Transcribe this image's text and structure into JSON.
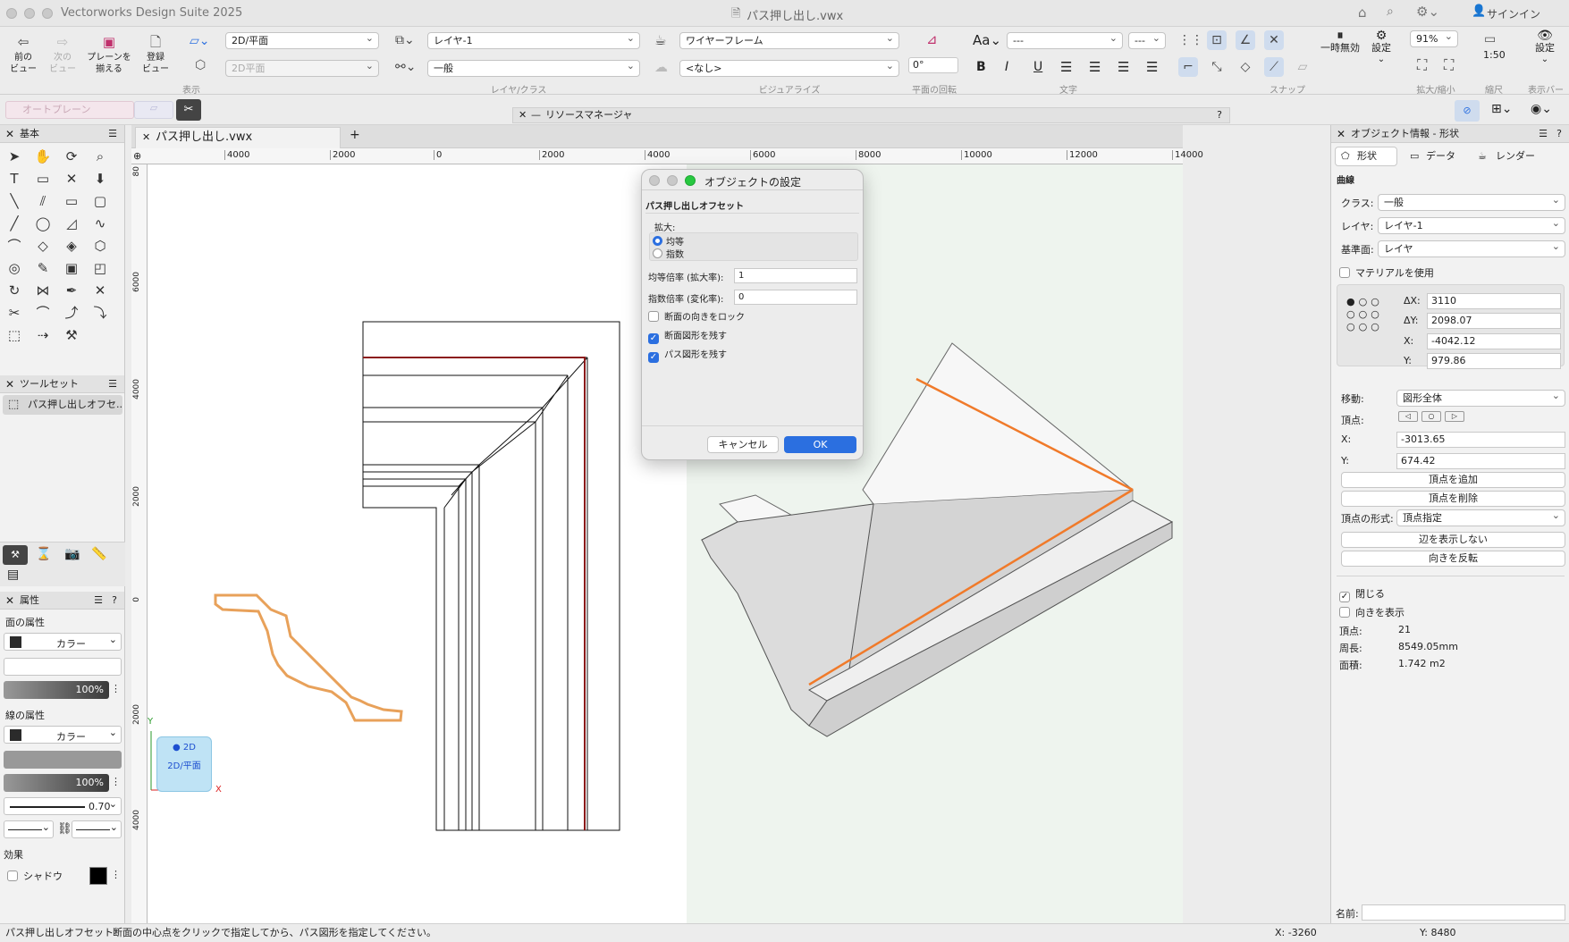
{
  "app": {
    "title": "Vectorworks Design Suite 2025",
    "document": "パス押し出し.vwx",
    "signin": "サインイン"
  },
  "toolbar": {
    "prev_view": "前の\nビュー",
    "next_view": "次の\nビュー",
    "align_plane": "プレーンを\n揃える",
    "register_view": "登録\nビュー",
    "view_select": "2D/平面",
    "plane_select": "2D平面",
    "layer_select": "レイヤ-1",
    "class_select": "一般",
    "render_select": "ワイヤーフレーム",
    "light_select": "<なし>",
    "rotation_value": "0°",
    "font_select": "---",
    "size_select": "---",
    "pause_label": "一時無効",
    "settings_label": "設定",
    "zoom_value": "91%",
    "scale_value": "1:50",
    "display_settings": "設定",
    "group_view": "表示",
    "group_layer": "レイヤ/クラス",
    "group_visual": "ビジュアライズ",
    "group_rot": "平面の回転",
    "group_text": "文字",
    "group_snap": "スナップ",
    "group_zoom": "拡大/縮小",
    "group_scale": "縮尺",
    "group_displaybar": "表示バー"
  },
  "secondary": {
    "auto_plane": "オートプレーン",
    "resource_manager": "リソースマネージャ"
  },
  "tab": {
    "name": "パス押し出し.vwx",
    "add": "+"
  },
  "left": {
    "basic_title": "基本",
    "toolset_title": "ツールセット",
    "toolset_item": "パス押し出しオフセ...",
    "attr_title": "属性",
    "fill_label": "面の属性",
    "fill_type": "カラー",
    "fill_opacity": "100%",
    "line_label": "線の属性",
    "line_type": "カラー",
    "line_opacity": "100%",
    "line_weight": "0.70",
    "effect_label": "効果",
    "shadow_label": "シャドウ"
  },
  "ruler": {
    "h": [
      "4000",
      "2000",
      "0",
      "2000",
      "4000",
      "6000",
      "8000",
      "10000",
      "12000",
      "14000"
    ],
    "v": [
      "80",
      "6000",
      "4000",
      "2000",
      "0",
      "2000",
      "4000"
    ]
  },
  "view_badge": {
    "mode": "2D",
    "label": "2D/平面",
    "x": "X",
    "y": "Y"
  },
  "dialog": {
    "title": "オブジェクトの設定",
    "section": "パス押し出しオフセット",
    "scale_label": "拡大:",
    "radio_uniform": "均等",
    "radio_exp": "指数",
    "uniform_label": "均等倍率 (拡大率):",
    "uniform_value": "1",
    "exp_label": "指数倍率 (変化率):",
    "exp_value": "0",
    "lock_label": "断面の向きをロック",
    "keep_section": "断面図形を残す",
    "keep_path": "パス図形を残す",
    "cancel": "キャンセル",
    "ok": "OK"
  },
  "objinfo": {
    "title": "オブジェクト情報 - 形状",
    "tab_shape": "形状",
    "tab_data": "データ",
    "tab_render": "レンダー",
    "type": "曲線",
    "class_label": "クラス:",
    "class_value": "一般",
    "layer_label": "レイヤ:",
    "layer_value": "レイヤ-1",
    "plane_label": "基準面:",
    "plane_value": "レイヤ",
    "material_label": "マテリアルを使用",
    "dx_label": "ΔX:",
    "dx_value": "3110",
    "dy_label": "ΔY:",
    "dy_value": "2098.07",
    "x_label": "X:",
    "x_value": "-4042.12",
    "y_label": "Y:",
    "y_value": "979.86",
    "move_label": "移動:",
    "move_value": "図形全体",
    "vertex_label": "頂点:",
    "vx_label": "X:",
    "vx_value": "-3013.65",
    "vy_label": "Y:",
    "vy_value": "674.42",
    "add_vertex": "頂点を追加",
    "del_vertex": "頂点を削除",
    "vtype_label": "頂点の形式:",
    "vtype_value": "頂点指定",
    "hide_edge": "辺を表示しない",
    "reverse": "向きを反転",
    "closed_label": "閉じる",
    "show_dir": "向きを表示",
    "vcount_label": "頂点:",
    "vcount_value": "21",
    "perimeter_label": "周長:",
    "perimeter_value": "8549.05mm",
    "area_label": "面積:",
    "area_value": "1.742 m2",
    "name_label": "名前:"
  },
  "status": {
    "tool": "パス押し出しオフセット",
    "message": "断面の中心点をクリックで指定してから、パス図形を指定してください。",
    "x": "X: -3260",
    "y": "Y: 8480"
  },
  "colors": {
    "accent": "#2b6fe0",
    "profile": "#e8a15a",
    "highlight": "#f07a2a",
    "path": "#8b1a1a"
  }
}
